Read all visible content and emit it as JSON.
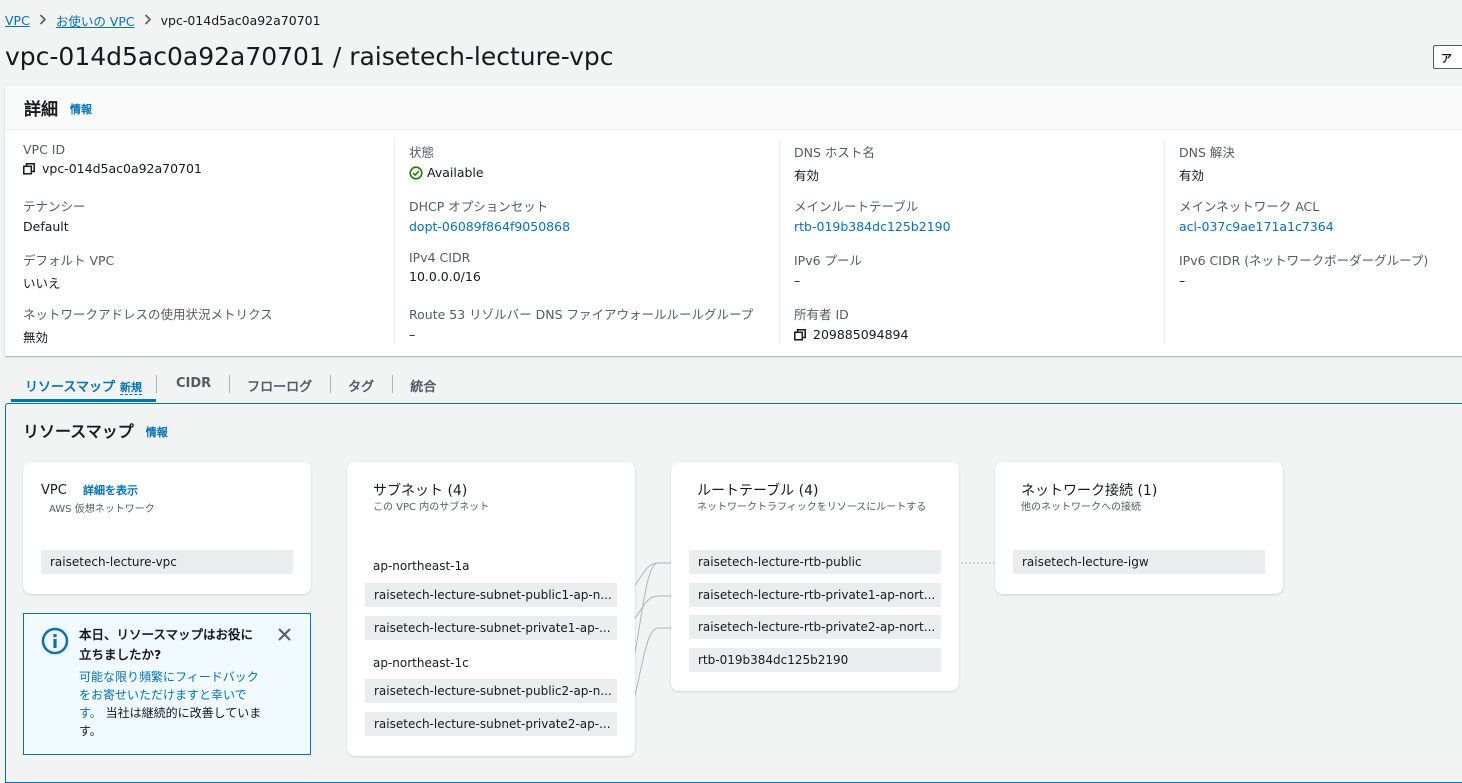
{
  "breadcrumb": {
    "root": "VPC",
    "parent": "お使いの VPC",
    "current": "vpc-014d5ac0a92a70701"
  },
  "page_title": "vpc-014d5ac0a92a70701 / raisetech-lecture-vpc",
  "actions_button": "ア",
  "details": {
    "heading": "詳細",
    "info": "情報",
    "columns": [
      [
        {
          "label": "VPC ID",
          "value": "vpc-014d5ac0a92a70701"
        },
        {
          "label": "テナンシー",
          "value": "Default"
        },
        {
          "label": "デフォルト VPC",
          "value": "いいえ"
        },
        {
          "label": "ネットワークアドレスの使用状況メトリクス",
          "value": "無効"
        }
      ],
      [
        {
          "label": "状態",
          "value": "Available"
        },
        {
          "label": "DHCP オプションセット",
          "value": "dopt-06089f864f9050868"
        },
        {
          "label": "IPv4 CIDR",
          "value": "10.0.0.0/16"
        },
        {
          "label": "Route 53 リゾルバー DNS ファイアウォールルールグループ",
          "value": "–"
        }
      ],
      [
        {
          "label": "DNS ホスト名",
          "value": "有効"
        },
        {
          "label": "メインルートテーブル",
          "value": "rtb-019b384dc125b2190"
        },
        {
          "label": "IPv6 プール",
          "value": "–"
        },
        {
          "label": "所有者 ID",
          "value": "209885094894"
        }
      ],
      [
        {
          "label": "DNS 解決",
          "value": "有効"
        },
        {
          "label": "メインネットワーク ACL",
          "value": "acl-037c9ae171a1c7364"
        },
        {
          "label": "IPv6 CIDR (ネットワークボーダーグループ)",
          "value": "–"
        }
      ]
    ]
  },
  "tabs": [
    {
      "label": "リソースマップ",
      "badge": "新規"
    },
    {
      "label": "CIDR"
    },
    {
      "label": "フローログ"
    },
    {
      "label": "タグ"
    },
    {
      "label": "統合"
    }
  ],
  "resource_map": {
    "title": "リソースマップ",
    "info": "情報",
    "vpc": {
      "title": "VPC",
      "detail_link": "詳細を表示",
      "sub": "AWS 仮想ネットワーク",
      "item": "raisetech-lecture-vpc"
    },
    "subnets": {
      "title": "サブネット (4)",
      "sub": "この VPC 内のサブネット",
      "az1": "ap-northeast-1a",
      "az1_items": [
        "raisetech-lecture-subnet-public1-ap-n...",
        "raisetech-lecture-subnet-private1-ap-..."
      ],
      "az2": "ap-northeast-1c",
      "az2_items": [
        "raisetech-lecture-subnet-public2-ap-n...",
        "raisetech-lecture-subnet-private2-ap-..."
      ]
    },
    "route_tables": {
      "title": "ルートテーブル (4)",
      "sub": "ネットワークトラフィックをリソースにルートする",
      "items": [
        "raisetech-lecture-rtb-public",
        "raisetech-lecture-rtb-private1-ap-nort...",
        "raisetech-lecture-rtb-private2-ap-nort...",
        "rtb-019b384dc125b2190"
      ]
    },
    "network": {
      "title": "ネットワーク接続 (1)",
      "sub": "他のネットワークへの接続",
      "items": [
        "raisetech-lecture-igw"
      ]
    },
    "feedback": {
      "title": "本日、リソースマップはお役に立ちましたか?",
      "link": "可能な限り頻繁にフィードバックをお寄せいただけますと幸いです。",
      "text": "当社は継続的に改善しています。"
    }
  },
  "colors": {
    "accent": "#0073bb",
    "success": "#1d8102",
    "chip": "#eaeded"
  }
}
